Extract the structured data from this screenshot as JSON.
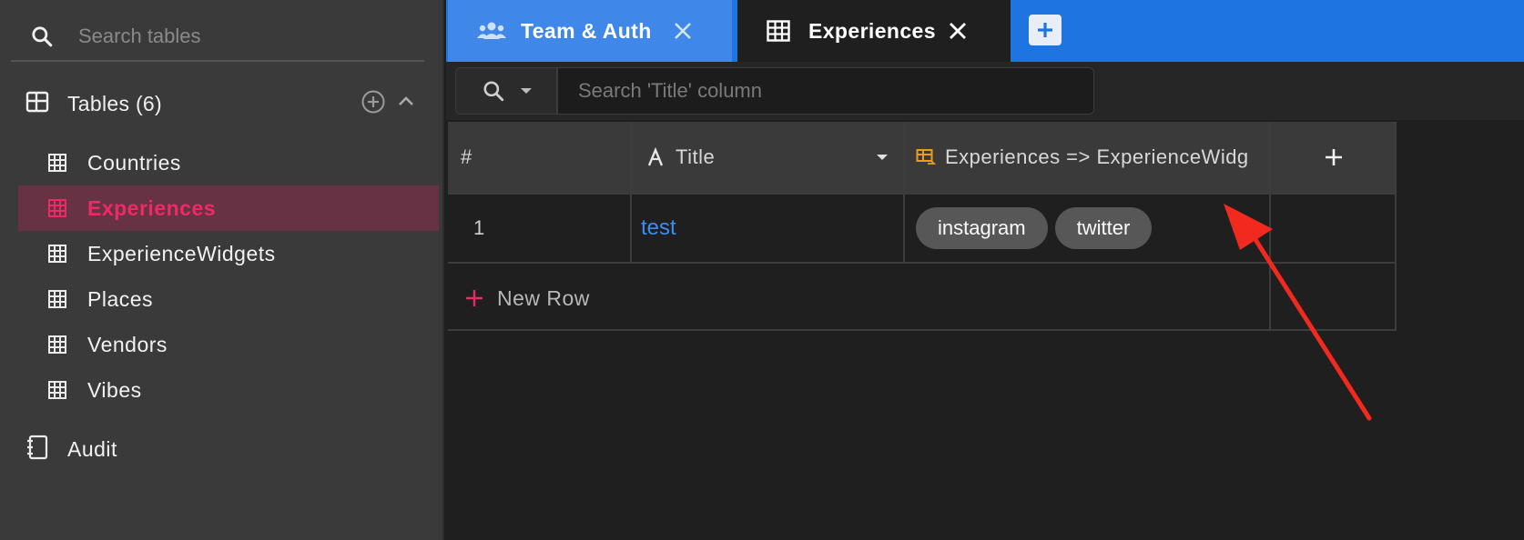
{
  "sidebar": {
    "search_placeholder": "Search tables",
    "tables_label": "Tables (6)",
    "items": [
      {
        "label": "Countries",
        "active": false
      },
      {
        "label": "Experiences",
        "active": true
      },
      {
        "label": "ExperienceWidgets",
        "active": false
      },
      {
        "label": "Places",
        "active": false
      },
      {
        "label": "Vendors",
        "active": false
      },
      {
        "label": "Vibes",
        "active": false
      }
    ],
    "audit_label": "Audit"
  },
  "tabs": [
    {
      "label": "Team & Auth",
      "icon": "team-icon"
    },
    {
      "label": "Experiences",
      "icon": "table-icon"
    }
  ],
  "toolbar": {
    "search_placeholder": "Search 'Title' column"
  },
  "grid": {
    "columns": [
      {
        "label": "#"
      },
      {
        "label": "Title",
        "icon": "text-type-icon"
      },
      {
        "label": "Experiences => ExperienceWidg",
        "icon": "link-table-icon"
      }
    ],
    "rows": [
      {
        "num": "1",
        "title": "test",
        "links": [
          "instagram",
          "twitter"
        ]
      }
    ],
    "new_row_label": "New Row"
  },
  "colors": {
    "accent": "#1e74e0",
    "active_item": "#ee2a66",
    "link_text": "#3c8df0",
    "arrow": "#f2291e"
  }
}
